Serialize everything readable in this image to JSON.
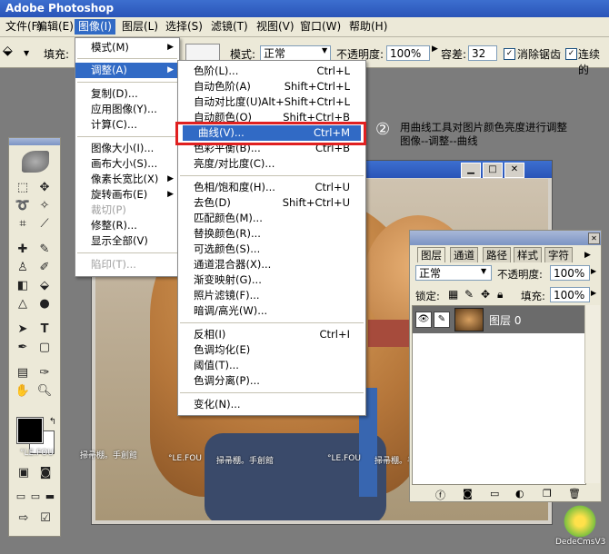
{
  "app": {
    "title": "Adobe Photoshop"
  },
  "menubar": [
    {
      "label": "文件(F)"
    },
    {
      "label": "编辑(E)"
    },
    {
      "label": "图像(I)"
    },
    {
      "label": "图层(L)"
    },
    {
      "label": "选择(S)"
    },
    {
      "label": "滤镜(T)"
    },
    {
      "label": "视图(V)"
    },
    {
      "label": "窗口(W)"
    },
    {
      "label": "帮助(H)"
    }
  ],
  "options": {
    "fill_label": "填充:",
    "mode_label": "模式:",
    "mode_value": "正常",
    "opacity_label": "不透明度:",
    "opacity_value": "100%",
    "tolerance_label": "容差:",
    "tolerance_value": "32",
    "antialias_label": "消除锯齿",
    "contiguous_label": "连续的"
  },
  "image_menu": [
    {
      "label": "模式(M)"
    },
    {
      "label": "调整(A)"
    },
    {
      "label": "复制(D)..."
    },
    {
      "label": "应用图像(Y)..."
    },
    {
      "label": "计算(C)..."
    },
    {
      "label": "图像大小(I)..."
    },
    {
      "label": "画布大小(S)..."
    },
    {
      "label": "像素长宽比(X)"
    },
    {
      "label": "旋转画布(E)"
    },
    {
      "label": "裁切(P)"
    },
    {
      "label": "修整(R)..."
    },
    {
      "label": "显示全部(V)"
    },
    {
      "label": "陷印(T)..."
    }
  ],
  "adjust_menu": [
    {
      "label": "色阶(L)...",
      "shortcut": "Ctrl+L"
    },
    {
      "label": "自动色阶(A)",
      "shortcut": "Shift+Ctrl+L"
    },
    {
      "label": "自动对比度(U)",
      "shortcut": "Alt+Shift+Ctrl+L"
    },
    {
      "label": "自动颜色(O)",
      "shortcut": "Shift+Ctrl+B"
    },
    {
      "label": "曲线(V)...",
      "shortcut": "Ctrl+M"
    },
    {
      "label": "色彩平衡(B)...",
      "shortcut": "Ctrl+B"
    },
    {
      "label": "亮度/对比度(C)...",
      "shortcut": ""
    },
    {
      "label": "色相/饱和度(H)...",
      "shortcut": "Ctrl+U"
    },
    {
      "label": "去色(D)",
      "shortcut": "Shift+Ctrl+U"
    },
    {
      "label": "匹配颜色(M)...",
      "shortcut": ""
    },
    {
      "label": "替换颜色(R)...",
      "shortcut": ""
    },
    {
      "label": "可选颜色(S)...",
      "shortcut": ""
    },
    {
      "label": "通道混合器(X)...",
      "shortcut": ""
    },
    {
      "label": "渐变映射(G)...",
      "shortcut": ""
    },
    {
      "label": "照片滤镜(F)...",
      "shortcut": ""
    },
    {
      "label": "暗调/高光(W)...",
      "shortcut": ""
    },
    {
      "label": "反相(I)",
      "shortcut": "Ctrl+I"
    },
    {
      "label": "色调均化(E)",
      "shortcut": ""
    },
    {
      "label": "阈值(T)...",
      "shortcut": ""
    },
    {
      "label": "色调分离(P)...",
      "shortcut": ""
    },
    {
      "label": "变化(N)...",
      "shortcut": ""
    }
  ],
  "annotation": {
    "number": "②",
    "line1": "用曲线工具对图片颜色亮度进行调整",
    "line2": "图像--调整--曲线"
  },
  "layers_panel": {
    "tabs": [
      "图层",
      "通道",
      "路径",
      "样式",
      "字符"
    ],
    "blend_mode": "正常",
    "opacity_label": "不透明度:",
    "opacity_value": "100%",
    "lock_label": "锁定:",
    "fill_label": "填充:",
    "fill_value": "100%",
    "layer_name": "图层 0"
  },
  "watermarks": {
    "w1": "°LE.FOU",
    "w2": "掃帚棚。手創館",
    "w3": "°LE.FOU",
    "w4": "掃帚棚。手創館",
    "w5": "°LE.FOU",
    "w6": "掃帚棚。手創館",
    "w7": "DedeCmsV3"
  },
  "colors": {
    "highlight": "#316ac5",
    "annotation_box": "#e02020",
    "titlebar": "#2a54b8"
  }
}
